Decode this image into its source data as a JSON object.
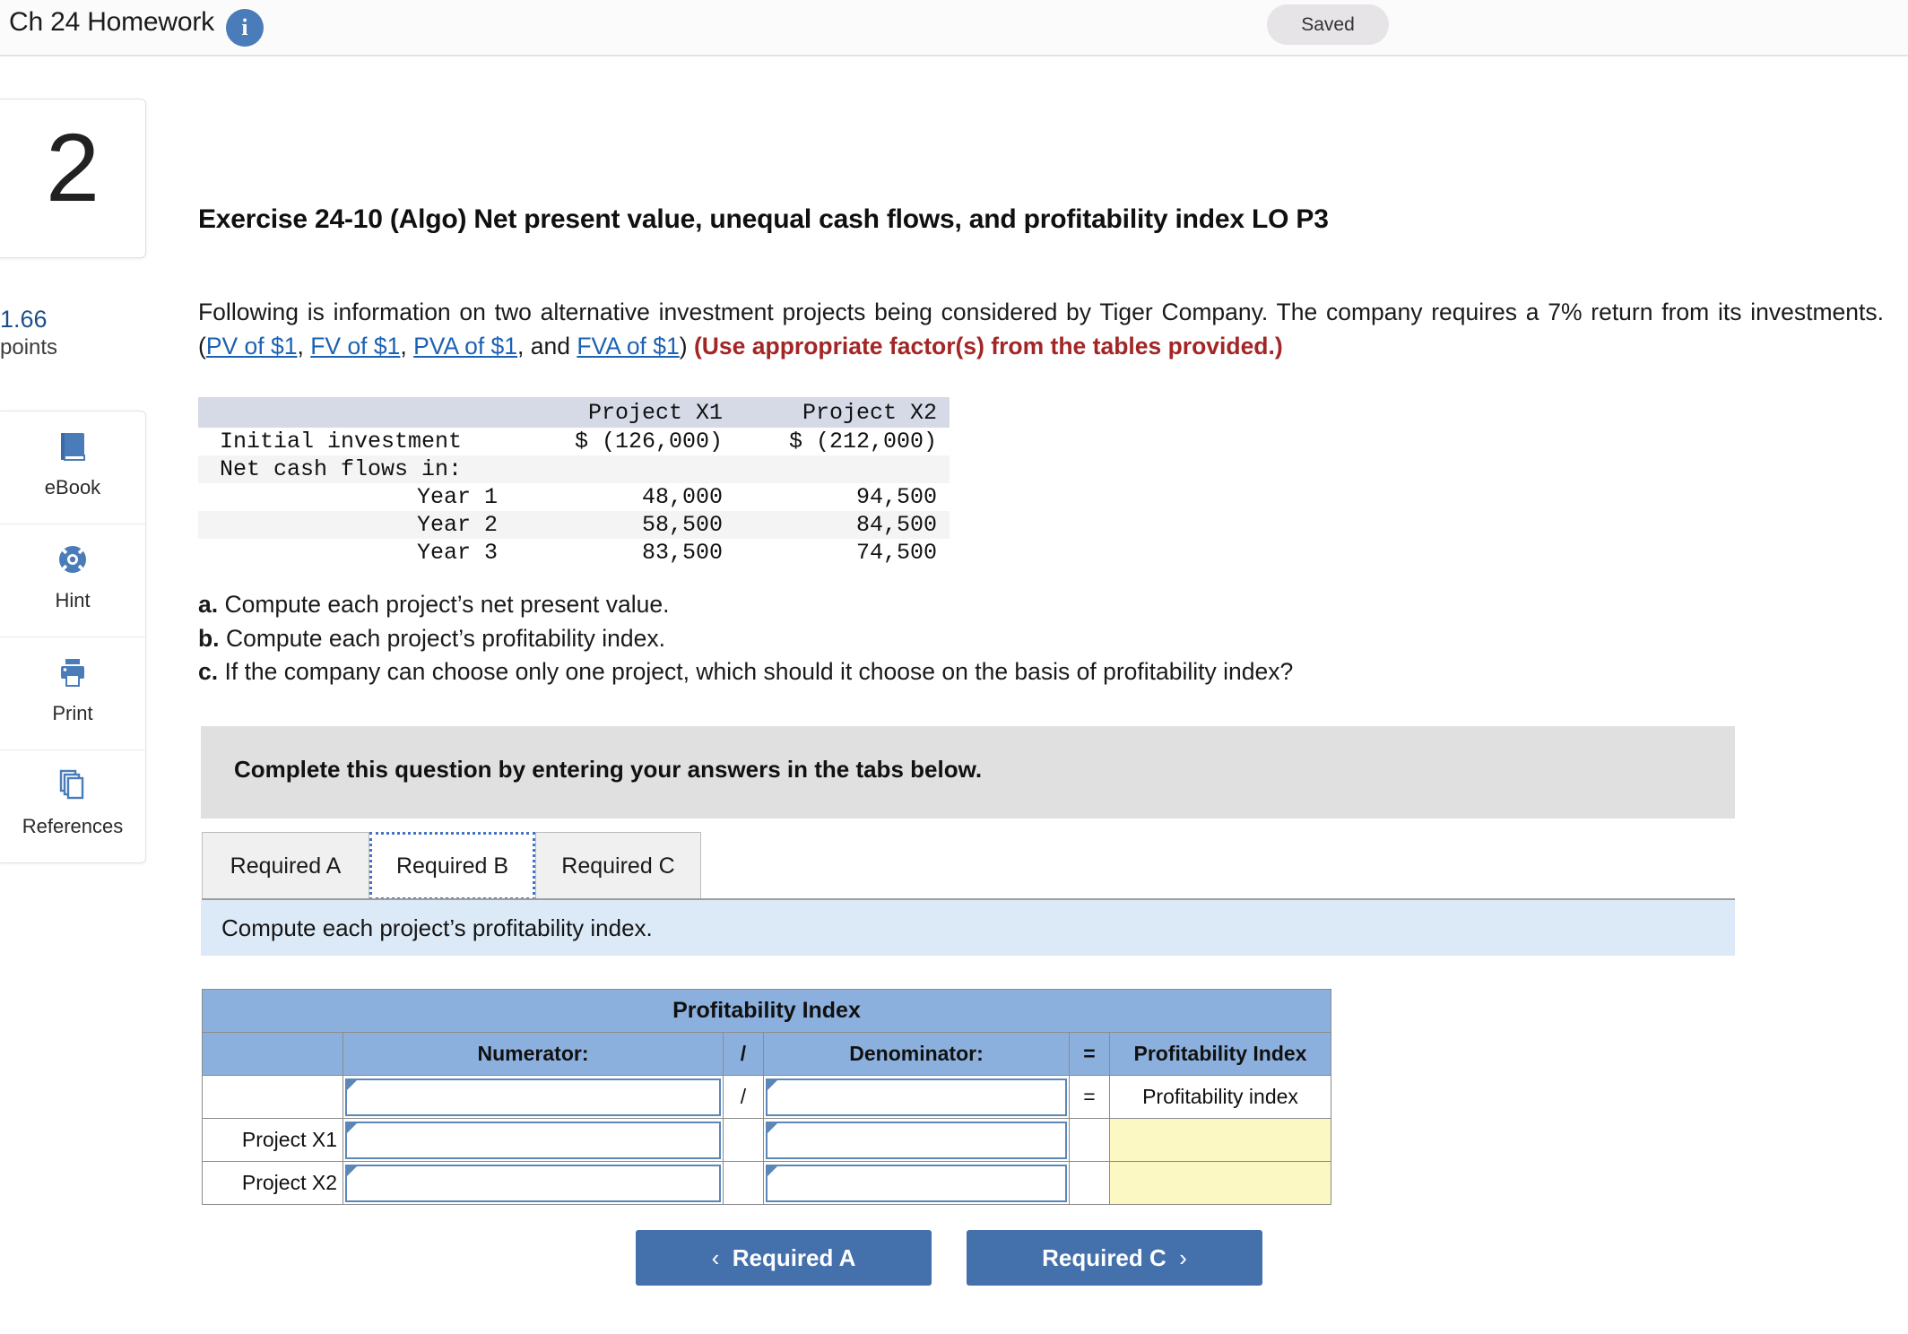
{
  "header": {
    "title": "Ch 24 Homework",
    "info_icon": "info-icon",
    "status_badge": "Saved"
  },
  "sidebar": {
    "question_number": "2",
    "points_value": "1.66",
    "points_label": "points",
    "tools": [
      {
        "icon": "ebook-icon",
        "label": "eBook"
      },
      {
        "icon": "life-ring-icon",
        "label": "Hint"
      },
      {
        "icon": "printer-icon",
        "label": "Print"
      },
      {
        "icon": "copy-pages-icon",
        "label": "References"
      }
    ]
  },
  "exercise": {
    "title": "Exercise 24-10 (Algo) Net present value, unequal cash flows, and profitability index LO P3",
    "intro_part1": "Following is information on two alternative investment projects being considered by Tiger Company. The company requires a 7% return from its investments. (",
    "links": [
      "PV of $1",
      "FV of $1",
      "PVA of $1",
      "FVA of $1"
    ],
    "intro_sep1": ", ",
    "intro_sep2": ", ",
    "intro_sep3": ", and ",
    "intro_close": ")",
    "intro_note": "(Use appropriate factor(s) from the tables provided.)"
  },
  "data_table": {
    "columns": [
      "",
      "Project X1",
      "Project X2"
    ],
    "rows": [
      {
        "label": "Initial investment",
        "indent": false,
        "x1": "$ (126,000)",
        "x2": "$ (212,000)"
      },
      {
        "label": "Net cash flows in:",
        "indent": false,
        "x1": "",
        "x2": ""
      },
      {
        "label": "Year 1",
        "indent": true,
        "x1": "48,000",
        "x2": "94,500"
      },
      {
        "label": "Year 2",
        "indent": true,
        "x1": "58,500",
        "x2": "84,500"
      },
      {
        "label": "Year 3",
        "indent": true,
        "x1": "83,500",
        "x2": "74,500"
      }
    ]
  },
  "requirements": [
    {
      "letter": "a.",
      "text": "Compute each project’s net present value."
    },
    {
      "letter": "b.",
      "text": "Compute each project’s profitability index."
    },
    {
      "letter": "c.",
      "text": "If the company can choose only one project, which should it choose on the basis of profitability index?"
    }
  ],
  "banner": {
    "text": "Complete this question by entering your answers in the tabs below."
  },
  "tabs": [
    {
      "label": "Required A",
      "active": false
    },
    {
      "label": "Required B",
      "active": true
    },
    {
      "label": "Required C",
      "active": false
    }
  ],
  "prompt": {
    "text": "Compute each project’s profitability index."
  },
  "answer_grid": {
    "title": "Profitability Index",
    "headers": [
      "",
      "Numerator:",
      "/",
      "Denominator:",
      "=",
      "Profitability Index"
    ],
    "rows": [
      {
        "label": "",
        "numerator": "",
        "operator1": "/",
        "denominator": "",
        "operator2": "=",
        "result": "Profitability index",
        "result_style": "text"
      },
      {
        "label": "Project X1",
        "numerator": "",
        "operator1": "",
        "denominator": "",
        "operator2": "",
        "result": "",
        "result_style": "yellow"
      },
      {
        "label": "Project X2",
        "numerator": "",
        "operator1": "",
        "denominator": "",
        "operator2": "",
        "result": "",
        "result_style": "yellow"
      }
    ]
  },
  "footer_nav": {
    "prev_label": "Required A",
    "next_label": "Required C",
    "prev_chevron": "‹",
    "next_chevron": "›"
  },
  "colors": {
    "accent_blue": "#4470ab",
    "link_blue": "#1b62b5",
    "note_red": "#a32626",
    "table_header_blue": "#8cb0dd",
    "input_yellow": "#fcf8c4",
    "prompt_blue": "#dceaf7",
    "banner_gray": "#e0e0e0"
  }
}
